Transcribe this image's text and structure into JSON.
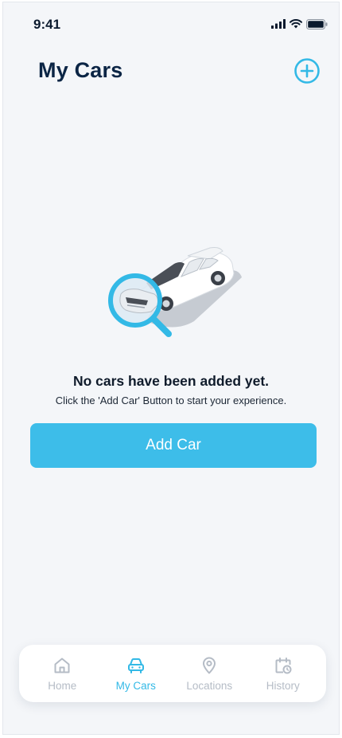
{
  "status_bar": {
    "time": "9:41"
  },
  "header": {
    "title": "My Cars"
  },
  "empty_state": {
    "title": "No cars have been added yet.",
    "subtitle": "Click the 'Add Car' Button to start your experience."
  },
  "actions": {
    "add_car_label": "Add Car"
  },
  "tabs": [
    {
      "label": "Home",
      "icon": "home-icon",
      "active": false
    },
    {
      "label": "My Cars",
      "icon": "car-icon",
      "active": true
    },
    {
      "label": "Locations",
      "icon": "location-pin-icon",
      "active": false
    },
    {
      "label": "History",
      "icon": "calendar-clock-icon",
      "active": false
    }
  ],
  "colors": {
    "accent": "#3dbde9",
    "title": "#0b2545",
    "inactive": "#b5bcc6",
    "background": "#f4f6f9"
  }
}
